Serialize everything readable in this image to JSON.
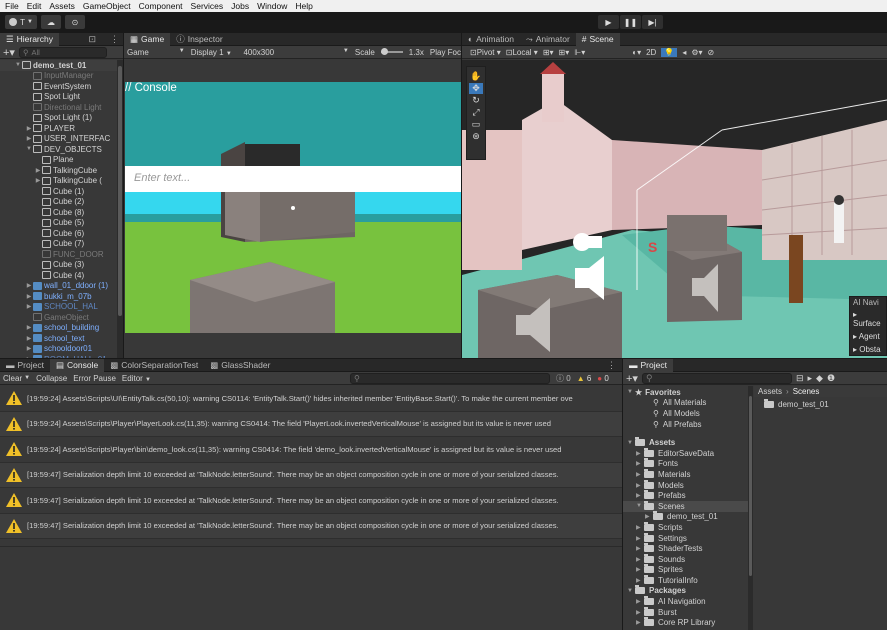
{
  "menu": [
    "File",
    "Edit",
    "Assets",
    "GameObject",
    "Component",
    "Services",
    "Jobs",
    "Window",
    "Help"
  ],
  "toolbar": {
    "account": "T",
    "play_icons": [
      "play-icon",
      "pause-icon",
      "step-icon"
    ]
  },
  "hierarchy": {
    "tab": "Hierarchy",
    "search_placeholder": "All",
    "items": [
      {
        "label": "demo_test_01",
        "indent": 0,
        "state": "root"
      },
      {
        "label": "InputManager",
        "indent": 1,
        "state": "dim"
      },
      {
        "label": "EventSystem",
        "indent": 1,
        "state": "normal"
      },
      {
        "label": "Spot Light",
        "indent": 1,
        "state": "normal"
      },
      {
        "label": "Directional Light",
        "indent": 1,
        "state": "dim"
      },
      {
        "label": "Spot Light (1)",
        "indent": 1,
        "state": "normal"
      },
      {
        "label": "PLAYER",
        "indent": 1,
        "state": "collapsed"
      },
      {
        "label": "USER_INTERFAC",
        "indent": 1,
        "state": "collapsed"
      },
      {
        "label": "DEV_OBJECTS",
        "indent": 1,
        "state": "expanded"
      },
      {
        "label": "Plane",
        "indent": 2,
        "state": "normal"
      },
      {
        "label": "TalkingCube",
        "indent": 2,
        "state": "collapsed"
      },
      {
        "label": "TalkingCube (",
        "indent": 2,
        "state": "collapsed"
      },
      {
        "label": "Cube (1)",
        "indent": 2,
        "state": "normal"
      },
      {
        "label": "Cube (2)",
        "indent": 2,
        "state": "normal"
      },
      {
        "label": "Cube (8)",
        "indent": 2,
        "state": "normal"
      },
      {
        "label": "Cube (5)",
        "indent": 2,
        "state": "normal"
      },
      {
        "label": "Cube (6)",
        "indent": 2,
        "state": "normal"
      },
      {
        "label": "Cube (7)",
        "indent": 2,
        "state": "normal"
      },
      {
        "label": "FUNC_DOOR",
        "indent": 2,
        "state": "dim"
      },
      {
        "label": "Cube (3)",
        "indent": 2,
        "state": "normal"
      },
      {
        "label": "Cube (4)",
        "indent": 2,
        "state": "normal"
      },
      {
        "label": "wall_01_ddoor (1)",
        "indent": 1,
        "state": "prefab"
      },
      {
        "label": "bukki_m_07b",
        "indent": 1,
        "state": "prefab"
      },
      {
        "label": "SCHOOL_HAL",
        "indent": 1,
        "state": "prefab-dim"
      },
      {
        "label": "GameObject",
        "indent": 1,
        "state": "dim"
      },
      {
        "label": "school_building",
        "indent": 1,
        "state": "prefab"
      },
      {
        "label": "school_text",
        "indent": 1,
        "state": "prefab"
      },
      {
        "label": "schooldoor01",
        "indent": 1,
        "state": "prefab"
      },
      {
        "label": "ROOM_HALL_01",
        "indent": 1,
        "state": "prefab-dim"
      }
    ]
  },
  "game": {
    "tabs": [
      "Game",
      "Inspector"
    ],
    "display_mode": "Game",
    "display": "Display 1",
    "resolution": "400x300",
    "scale_label": "Scale",
    "scale_value": "1.3x",
    "play_focus": "Play Foc",
    "overlay_title": "// Console",
    "input_placeholder": "Enter text..."
  },
  "scene": {
    "tabs": [
      "Animation",
      "Animator",
      "Scene"
    ],
    "pivot": "Pivot",
    "space": "Local",
    "mode_2d": "2D",
    "overlay_title": "AI Navi",
    "overlay_items": [
      "Surface",
      "Agent",
      "Obsta"
    ]
  },
  "console": {
    "tabs": [
      "Project",
      "Console",
      "ColorSeparationTest",
      "GlassShader"
    ],
    "toolbar": [
      "Clear",
      "Collapse",
      "Error Pause",
      "Editor"
    ],
    "counts": {
      "info": "0",
      "warn": "6",
      "error": "0"
    },
    "messages": [
      "[19:59:24] Assets\\Scripts\\UI\\EntityTalk.cs(50,10): warning CS0114: 'EntityTalk.Start()' hides inherited member 'EntityBase.Start()'. To make the current member ove",
      "[19:59:24] Assets\\Scripts\\Player\\PlayerLook.cs(11,35): warning CS0414: The field 'PlayerLook.invertedVerticalMouse' is assigned but its value is never used",
      "[19:59:24] Assets\\Scripts\\Player\\bin\\demo_look.cs(11,35): warning CS0414: The field 'demo_look.invertedVerticalMouse' is assigned but its value is never used",
      "[19:59:47] Serialization depth limit 10 exceeded at 'TalkNode.letterSound'. There may be an object composition cycle in one or more of your serialized classes.",
      "[19:59:47] Serialization depth limit 10 exceeded at 'TalkNode.letterSound'. There may be an object composition cycle in one or more of your serialized classes.",
      "[19:59:47] Serialization depth limit 10 exceeded at 'TalkNode.letterSound'. There may be an object composition cycle in one or more of your serialized classes."
    ]
  },
  "project": {
    "tab": "Project",
    "favorites_label": "Favorites",
    "favorites": [
      "All Materials",
      "All Models",
      "All Prefabs"
    ],
    "assets_label": "Assets",
    "assets": [
      {
        "label": "EditorSaveData",
        "indent": 1
      },
      {
        "label": "Fonts",
        "indent": 1
      },
      {
        "label": "Materials",
        "indent": 1
      },
      {
        "label": "Models",
        "indent": 1
      },
      {
        "label": "Prefabs",
        "indent": 1
      },
      {
        "label": "Scenes",
        "indent": 1,
        "selected": true
      },
      {
        "label": "demo_test_01",
        "indent": 2
      },
      {
        "label": "Scripts",
        "indent": 1
      },
      {
        "label": "Settings",
        "indent": 1
      },
      {
        "label": "ShaderTests",
        "indent": 1
      },
      {
        "label": "Sounds",
        "indent": 1
      },
      {
        "label": "Sprites",
        "indent": 1
      },
      {
        "label": "TutorialInfo",
        "indent": 1
      }
    ],
    "packages_label": "Packages",
    "packages": [
      "AI Navigation",
      "Burst",
      "Core RP Library"
    ],
    "breadcrumb": [
      "Assets",
      "Scenes"
    ],
    "content": [
      "demo_test_01"
    ]
  }
}
